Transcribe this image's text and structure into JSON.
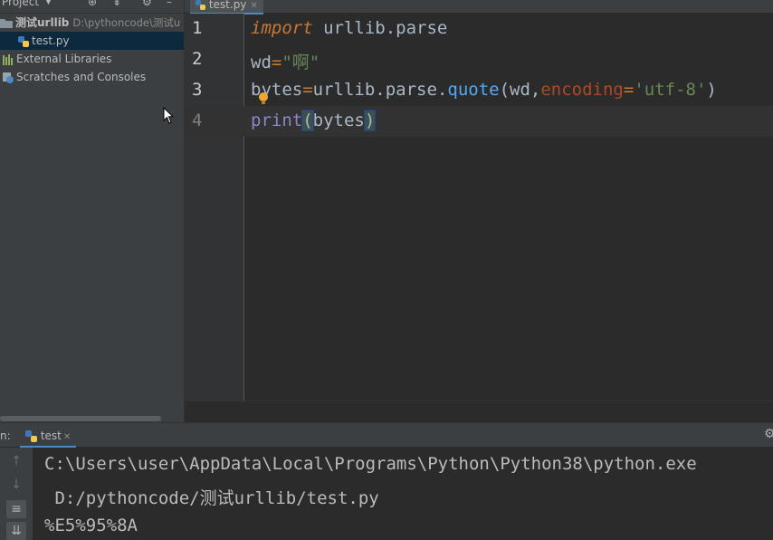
{
  "project_panel": {
    "header_label": "Project",
    "tree": [
      {
        "label": "测试urllib",
        "path": "D:\\pythoncode\\测试u",
        "icon": "folder-icon"
      },
      {
        "label": "test.py",
        "icon": "python-file-icon"
      },
      {
        "label": "External Libraries",
        "icon": "library-icon"
      },
      {
        "label": "Scratches and Consoles",
        "icon": "scratches-icon"
      }
    ]
  },
  "editor": {
    "tab_label": "test.py",
    "line_numbers": [
      "1",
      "2",
      "3",
      "4"
    ],
    "lines": [
      [
        "import",
        " urllib.parse"
      ],
      [
        "wd",
        "=",
        "\"啊\""
      ],
      [
        "b",
        "ytes",
        "=",
        "urllib.parse.",
        "quote",
        "(wd,",
        "encoding",
        "=",
        "'utf-8'",
        ")"
      ],
      [
        "print",
        "(",
        "bytes",
        ")"
      ]
    ]
  },
  "run_panel": {
    "label_prefix": "n:",
    "tab_label": "test",
    "output": [
      "C:\\Users\\user\\AppData\\Local\\Programs\\Python\\Python38\\python.exe",
      " D:/pythoncode/测试urllib/test.py",
      "%E5%95%8A"
    ]
  },
  "colors": {
    "keyword": "#cc7832",
    "string": "#6a8759",
    "builtin": "#8888c6",
    "method": "#56a8f5",
    "param": "#aa4926",
    "accent": "#4a88c7"
  }
}
